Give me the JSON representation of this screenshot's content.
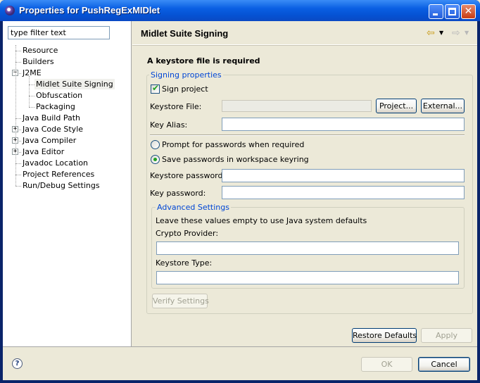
{
  "window": {
    "title": "Properties for PushRegExMIDlet",
    "minimize_glyph": "",
    "maximize_glyph": "",
    "close_glyph": "✕"
  },
  "icons": {
    "app": "eclipse-icon",
    "help": "help-icon",
    "back": "back-arrow-icon",
    "forward": "forward-arrow-icon",
    "check": "checkmark-icon"
  },
  "glyphs": {
    "help": "?",
    "back": "⇦",
    "forward": "⇨",
    "dropdown": "▼",
    "check": "✔",
    "expand": "+",
    "collapse": "−"
  },
  "filter": {
    "value": "type filter text",
    "placeholder": "type filter text"
  },
  "tree": [
    {
      "label": "Resource",
      "level": 0,
      "expander": ""
    },
    {
      "label": "Builders",
      "level": 0,
      "expander": ""
    },
    {
      "label": "J2ME",
      "level": 0,
      "expander": "collapse"
    },
    {
      "label": "Midlet Suite Signing",
      "level": 1,
      "expander": "",
      "selected": true
    },
    {
      "label": "Obfuscation",
      "level": 1,
      "expander": ""
    },
    {
      "label": "Packaging",
      "level": 1,
      "expander": ""
    },
    {
      "label": "Java Build Path",
      "level": 0,
      "expander": ""
    },
    {
      "label": "Java Code Style",
      "level": 0,
      "expander": "expand"
    },
    {
      "label": "Java Compiler",
      "level": 0,
      "expander": "expand"
    },
    {
      "label": "Java Editor",
      "level": 0,
      "expander": "expand"
    },
    {
      "label": "Javadoc Location",
      "level": 0,
      "expander": ""
    },
    {
      "label": "Project References",
      "level": 0,
      "expander": ""
    },
    {
      "label": "Run/Debug Settings",
      "level": 0,
      "expander": ""
    }
  ],
  "page": {
    "title": "Midlet Suite Signing",
    "message": "A keystore file is required"
  },
  "signing": {
    "legend": "Signing properties",
    "sign_project_label": "Sign project",
    "sign_project_checked": true,
    "keystore_file_label": "Keystore File:",
    "keystore_file_value": "",
    "project_button": "Project...",
    "external_button": "External...",
    "key_alias_label": "Key Alias:",
    "key_alias_value": "",
    "prompt_radio_label": "Prompt for passwords when required",
    "save_radio_label": "Save passwords in workspace keyring",
    "selected_radio": "save",
    "keystore_password_label": "Keystore password:",
    "keystore_password_value": "",
    "key_password_label": "Key password:",
    "key_password_value": "",
    "verify_button": "Verify Settings"
  },
  "advanced": {
    "legend": "Advanced Settings",
    "note": "Leave these values empty to use Java system defaults",
    "crypto_provider_label": "Crypto Provider:",
    "crypto_provider_value": "",
    "keystore_type_label": "Keystore Type:",
    "keystore_type_value": ""
  },
  "page_buttons": {
    "restore_defaults": "Restore Defaults",
    "apply": "Apply"
  },
  "dialog_buttons": {
    "ok": "OK",
    "cancel": "Cancel"
  }
}
